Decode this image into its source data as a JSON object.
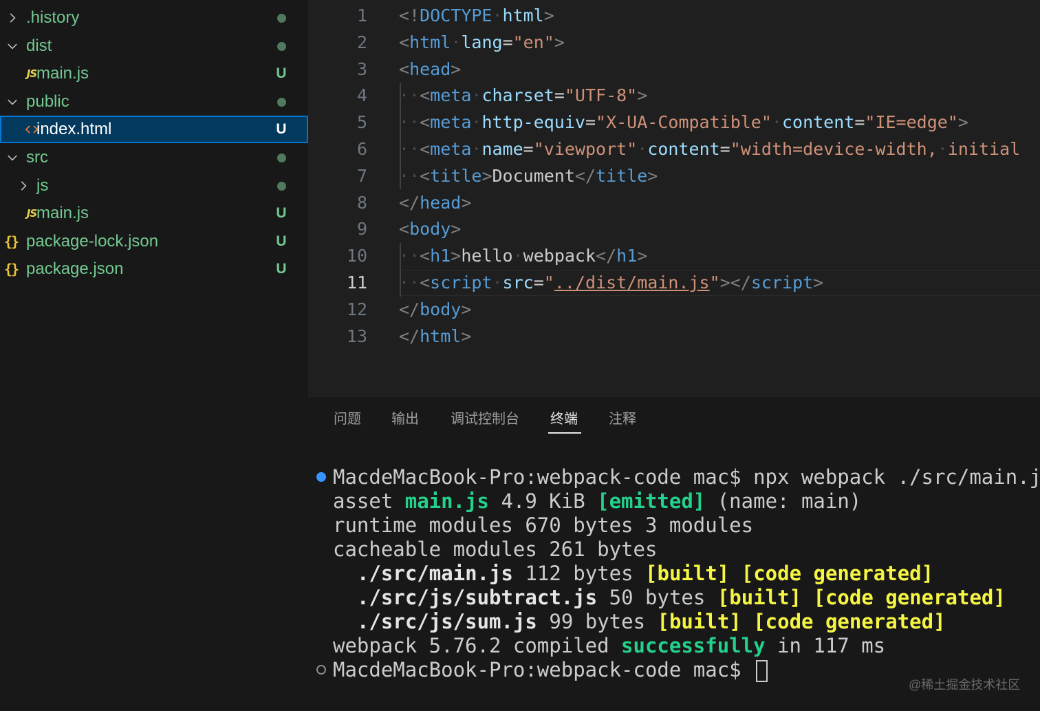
{
  "explorer": {
    "items": [
      {
        "label": ".history",
        "kind": "folder-collapsed",
        "status": "dot",
        "color": "#73c991"
      },
      {
        "label": "dist",
        "kind": "folder-expanded",
        "status": "dot",
        "color": "#73c991"
      },
      {
        "label": "main.js",
        "kind": "js-file",
        "status": "U",
        "color": "#73c991",
        "icon_text": "JS"
      },
      {
        "label": "public",
        "kind": "folder-expanded",
        "status": "dot",
        "color": "#73c991"
      },
      {
        "label": "index.html",
        "kind": "html-file",
        "status": "U",
        "color": "#ffffff",
        "selected": true
      },
      {
        "label": "src",
        "kind": "folder-expanded",
        "status": "dot",
        "color": "#73c991"
      },
      {
        "label": "js",
        "kind": "folder-collapsed",
        "status": "dot",
        "color": "#73c991"
      },
      {
        "label": "main.js",
        "kind": "js-file",
        "status": "U",
        "color": "#73c991",
        "icon_text": "JS"
      },
      {
        "label": "package-lock.json",
        "kind": "json-file",
        "status": "U",
        "color": "#73c991",
        "icon_text": "{}"
      },
      {
        "label": "package.json",
        "kind": "json-file",
        "status": "U",
        "color": "#73c991",
        "icon_text": "{}"
      }
    ]
  },
  "editor": {
    "active_line": "11",
    "lines": [
      {
        "n": "1",
        "tokens": [
          [
            "br",
            "<!"
          ],
          [
            "doc",
            "DOCTYPE"
          ],
          [
            "ws",
            "·"
          ],
          [
            "attr",
            "html"
          ],
          [
            "br",
            ">"
          ]
        ]
      },
      {
        "n": "2",
        "tokens": [
          [
            "br",
            "<"
          ],
          [
            "tag",
            "html"
          ],
          [
            "ws",
            "·"
          ],
          [
            "attr",
            "lang"
          ],
          [
            "txt",
            "="
          ],
          [
            "str",
            "\"en\""
          ],
          [
            "br",
            ">"
          ]
        ]
      },
      {
        "n": "3",
        "tokens": [
          [
            "br",
            "<"
          ],
          [
            "tag",
            "head"
          ],
          [
            "br",
            ">"
          ]
        ]
      },
      {
        "n": "4",
        "tokens": [
          [
            "ws",
            "··"
          ],
          [
            "br",
            "<"
          ],
          [
            "tag",
            "meta"
          ],
          [
            "ws",
            "·"
          ],
          [
            "attr",
            "charset"
          ],
          [
            "txt",
            "="
          ],
          [
            "str",
            "\"UTF-8\""
          ],
          [
            "br",
            ">"
          ]
        ]
      },
      {
        "n": "5",
        "tokens": [
          [
            "ws",
            "··"
          ],
          [
            "br",
            "<"
          ],
          [
            "tag",
            "meta"
          ],
          [
            "ws",
            "·"
          ],
          [
            "attr",
            "http-equiv"
          ],
          [
            "txt",
            "="
          ],
          [
            "str",
            "\"X-UA-Compatible\""
          ],
          [
            "ws",
            "·"
          ],
          [
            "attr",
            "content"
          ],
          [
            "txt",
            "="
          ],
          [
            "str",
            "\"IE=edge\""
          ],
          [
            "br",
            ">"
          ]
        ]
      },
      {
        "n": "6",
        "tokens": [
          [
            "ws",
            "··"
          ],
          [
            "br",
            "<"
          ],
          [
            "tag",
            "meta"
          ],
          [
            "ws",
            "·"
          ],
          [
            "attr",
            "name"
          ],
          [
            "txt",
            "="
          ],
          [
            "str",
            "\"viewport\""
          ],
          [
            "ws",
            "·"
          ],
          [
            "attr",
            "content"
          ],
          [
            "txt",
            "="
          ],
          [
            "str",
            "\"width=device-width,"
          ],
          [
            "ws",
            "·"
          ],
          [
            "str",
            "initial"
          ]
        ]
      },
      {
        "n": "7",
        "tokens": [
          [
            "ws",
            "··"
          ],
          [
            "br",
            "<"
          ],
          [
            "tag",
            "title"
          ],
          [
            "br",
            ">"
          ],
          [
            "txt",
            "Document"
          ],
          [
            "br",
            "</"
          ],
          [
            "tag",
            "title"
          ],
          [
            "br",
            ">"
          ]
        ]
      },
      {
        "n": "8",
        "tokens": [
          [
            "br",
            "</"
          ],
          [
            "tag",
            "head"
          ],
          [
            "br",
            ">"
          ]
        ]
      },
      {
        "n": "9",
        "tokens": [
          [
            "br",
            "<"
          ],
          [
            "tag",
            "body"
          ],
          [
            "br",
            ">"
          ]
        ]
      },
      {
        "n": "10",
        "tokens": [
          [
            "ws",
            "··"
          ],
          [
            "br",
            "<"
          ],
          [
            "tag",
            "h1"
          ],
          [
            "br",
            ">"
          ],
          [
            "txt",
            "hello"
          ],
          [
            "ws",
            "·"
          ],
          [
            "txt",
            "webpack"
          ],
          [
            "br",
            "</"
          ],
          [
            "tag",
            "h1"
          ],
          [
            "br",
            ">"
          ]
        ]
      },
      {
        "n": "11",
        "tokens": [
          [
            "ws",
            "··"
          ],
          [
            "br",
            "<"
          ],
          [
            "tag",
            "script"
          ],
          [
            "ws",
            "·"
          ],
          [
            "attr",
            "src"
          ],
          [
            "txt",
            "="
          ],
          [
            "str",
            "\""
          ],
          [
            "link",
            "../dist/main.js"
          ],
          [
            "str",
            "\""
          ],
          [
            "br",
            "></"
          ],
          [
            "tag",
            "script"
          ],
          [
            "br",
            ">"
          ]
        ]
      },
      {
        "n": "12",
        "tokens": [
          [
            "br",
            "</"
          ],
          [
            "tag",
            "body"
          ],
          [
            "br",
            ">"
          ]
        ]
      },
      {
        "n": "13",
        "tokens": [
          [
            "br",
            "</"
          ],
          [
            "tag",
            "html"
          ],
          [
            "br",
            ">"
          ]
        ]
      }
    ]
  },
  "panel": {
    "tabs": [
      {
        "label": "问题",
        "active": false
      },
      {
        "label": "输出",
        "active": false
      },
      {
        "label": "调试控制台",
        "active": false
      },
      {
        "label": "终端",
        "active": true
      },
      {
        "label": "注释",
        "active": false
      }
    ]
  },
  "terminal": {
    "lines": [
      {
        "dot": "blue",
        "indent": 0,
        "segs": [
          [
            "plain",
            "MacdeMacBook-Pro:webpack-code mac$ npx webpack ./src/main.j"
          ]
        ]
      },
      {
        "indent": 0,
        "segs": [
          [
            "plain",
            "asset "
          ],
          [
            "green",
            "main.js"
          ],
          [
            "plain",
            " 4.9 KiB "
          ],
          [
            "green",
            "[emitted]"
          ],
          [
            "plain",
            " (name: main)"
          ]
        ]
      },
      {
        "indent": 0,
        "segs": [
          [
            "plain",
            "runtime modules 670 bytes 3 modules"
          ]
        ]
      },
      {
        "indent": 0,
        "segs": [
          [
            "plain",
            "cacheable modules 261 bytes"
          ]
        ]
      },
      {
        "indent": 1,
        "segs": [
          [
            "bold",
            "./src/main.js"
          ],
          [
            "plain",
            " 112 bytes "
          ],
          [
            "yellow",
            "[built]"
          ],
          [
            "plain",
            " "
          ],
          [
            "yellow",
            "[code generated]"
          ]
        ]
      },
      {
        "indent": 1,
        "segs": [
          [
            "bold",
            "./src/js/subtract.js"
          ],
          [
            "plain",
            " 50 bytes "
          ],
          [
            "yellow",
            "[built]"
          ],
          [
            "plain",
            " "
          ],
          [
            "yellow",
            "[code generated]"
          ]
        ]
      },
      {
        "indent": 1,
        "segs": [
          [
            "bold",
            "./src/js/sum.js"
          ],
          [
            "plain",
            " 99 bytes "
          ],
          [
            "yellow",
            "[built]"
          ],
          [
            "plain",
            " "
          ],
          [
            "yellow",
            "[code generated]"
          ]
        ]
      },
      {
        "indent": 0,
        "segs": [
          [
            "plain",
            "webpack 5.76.2 compiled "
          ],
          [
            "green",
            "successfully"
          ],
          [
            "plain",
            " in 117 ms"
          ]
        ]
      },
      {
        "dot": "hollow",
        "indent": 0,
        "cursor": true,
        "segs": [
          [
            "plain",
            "MacdeMacBook-Pro:webpack-code mac$ "
          ]
        ]
      }
    ]
  },
  "watermark": "@稀土掘金技术社区",
  "colors": {
    "git_untracked": "#73c991",
    "selection_border": "#0078d4",
    "html_tag": "#569cd6",
    "html_attr": "#9cdcfe",
    "html_string": "#ce9178",
    "terminal_green": "#23d18b",
    "terminal_yellow": "#f5f543"
  }
}
